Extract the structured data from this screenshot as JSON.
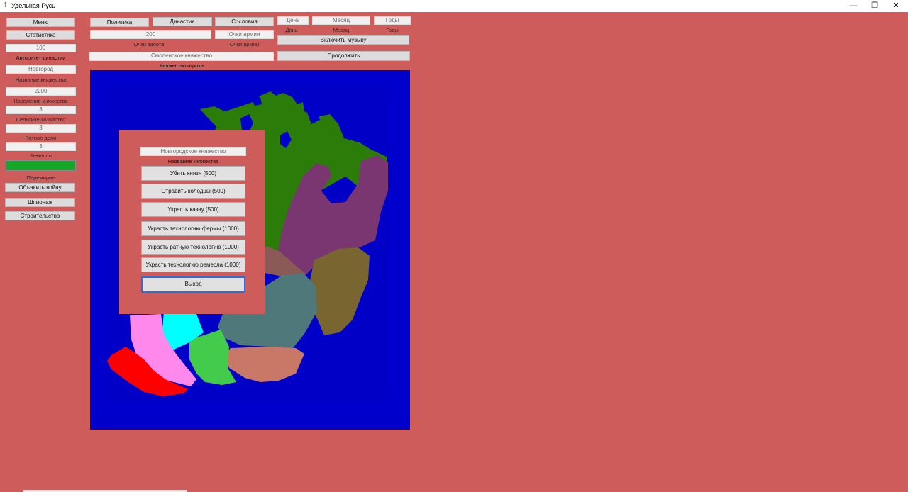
{
  "window": {
    "title": "Удельная Русь",
    "controls": {
      "minimize": "—",
      "restore": "❐",
      "close": "✕"
    }
  },
  "colors": {
    "background": "#cd5c5a",
    "map_sea": "#0000cd",
    "progress": "#14a826"
  },
  "left_panel": {
    "menu": "Меню",
    "stats": "Статистика",
    "dynasty_authority_value": "100",
    "dynasty_authority_label": "Авторитет династии",
    "principality_name_value": "Новгород",
    "principality_name_label": "Название княжества",
    "population_value": "2200",
    "population_label": "Население княжества",
    "agriculture_value": "3",
    "agriculture_label": "Сельское хозяйство",
    "military_value": "3",
    "military_label": "Ратное дело",
    "craft_value": "3",
    "craft_label": "Ремесло",
    "truce_label": "Перемирие",
    "declare_war": "Объявить войну",
    "espionage": "Шпионаж",
    "construction": "Строительство"
  },
  "top_bar": {
    "politics": "Политика",
    "dynasty": "Династия",
    "estates": "Сословия",
    "gold_value": "200",
    "gold_label": "Очки золота",
    "army_value": "Очки армии",
    "army_label": "Очки армии",
    "player_principality_value": "Смоленское княжество",
    "player_principality_label": "Княжество игрока",
    "day_value": "День",
    "day_label": "День",
    "month_value": "Месяц",
    "month_label": "Месяц",
    "years_value": "Годы",
    "years_label": "Годы",
    "music": "Включить музыку",
    "continue": "Продолжить"
  },
  "dialog": {
    "principality_value": "Новгородское княжество",
    "principality_label": "Название княжества",
    "actions": [
      "Убить князя (500)",
      "Отравить колодцы (500)",
      "Украсть казну (500)",
      "Украсть технологию фермы (1000)",
      "Украсть ратную технологию (1000)",
      "Украсть технологию ремесла (1000)"
    ],
    "exit": "Выход"
  }
}
